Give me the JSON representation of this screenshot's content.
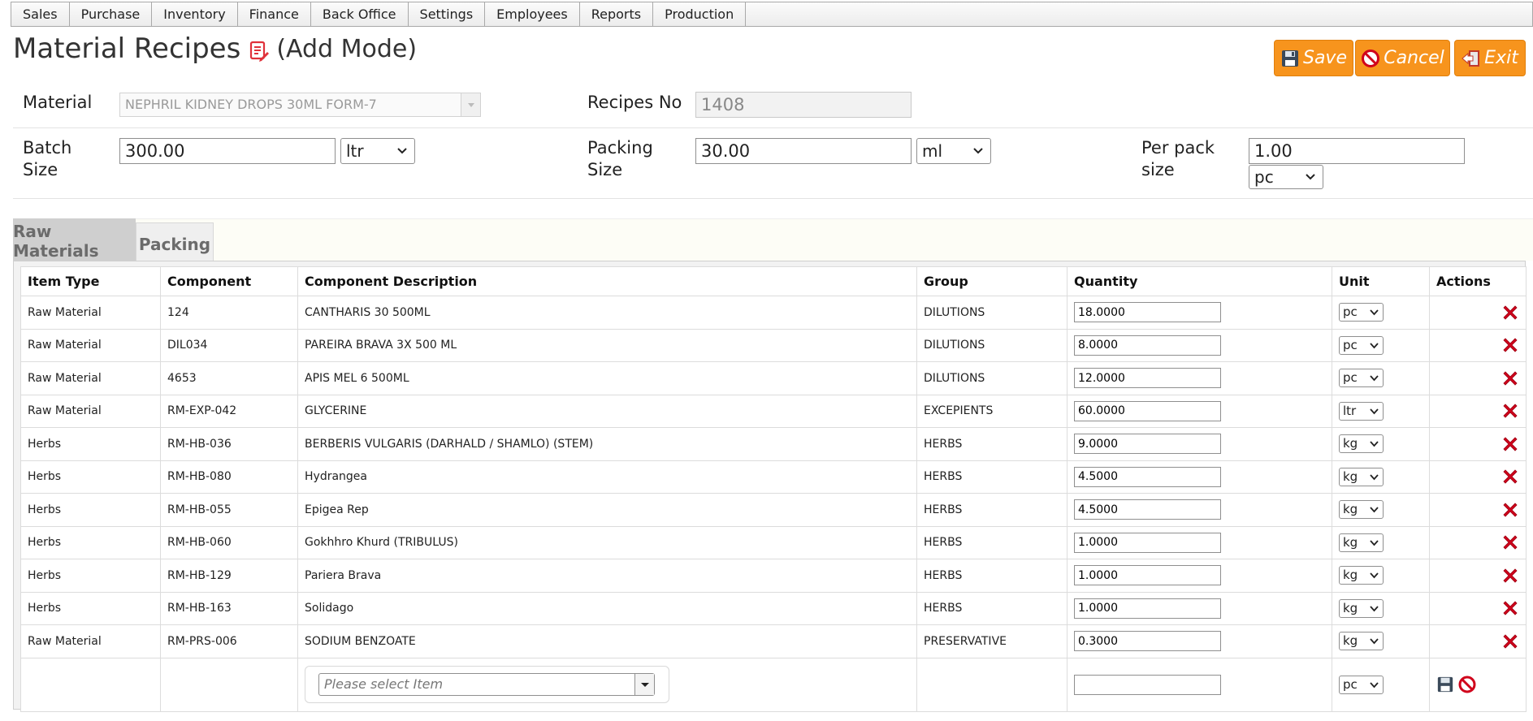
{
  "menu": [
    "Sales",
    "Purchase",
    "Inventory",
    "Finance",
    "Back Office",
    "Settings",
    "Employees",
    "Reports",
    "Production"
  ],
  "title": {
    "text": "Material Recipes",
    "mode": "(Add Mode)"
  },
  "buttons": {
    "save": "Save",
    "cancel": "Cancel",
    "exit": "Exit"
  },
  "form": {
    "material_label": "Material",
    "material_value": "NEPHRIL KIDNEY DROPS 30ML FORM-7",
    "recipes_no_label": "Recipes No",
    "recipes_no_value": "1408",
    "batch_size_label_1": "Batch",
    "batch_size_label_2": "Size",
    "batch_size_value": "300.00",
    "batch_unit": "ltr",
    "packing_size_label_1": "Packing",
    "packing_size_label_2": "Size",
    "packing_size_value": "30.00",
    "packing_unit": "ml",
    "per_pack_label_1": "Per pack",
    "per_pack_label_2": "size",
    "per_pack_value": "1.00",
    "per_pack_unit": "pc"
  },
  "tabs": {
    "raw_materials": "Raw Materials",
    "packing": "Packing"
  },
  "table": {
    "headers": [
      "Item Type",
      "Component",
      "Component Description",
      "Group",
      "Quantity",
      "Unit",
      "Actions"
    ],
    "rows": [
      {
        "type": "Raw Material",
        "component": "124",
        "description": "CANTHARIS 30 500ML",
        "group": "DILUTIONS",
        "qty": "18.0000",
        "unit": "pc"
      },
      {
        "type": "Raw Material",
        "component": "DIL034",
        "description": "PAREIRA BRAVA 3X 500 ML",
        "group": "DILUTIONS",
        "qty": "8.0000",
        "unit": "pc"
      },
      {
        "type": "Raw Material",
        "component": "4653",
        "description": "APIS MEL 6 500ML",
        "group": "DILUTIONS",
        "qty": "12.0000",
        "unit": "pc"
      },
      {
        "type": "Raw Material",
        "component": "RM-EXP-042",
        "description": "GLYCERINE",
        "group": "EXCEPIENTS",
        "qty": "60.0000",
        "unit": "ltr"
      },
      {
        "type": "Herbs",
        "component": "RM-HB-036",
        "description": "BERBERIS VULGARIS (DARHALD / SHAMLO) (STEM)",
        "group": "HERBS",
        "qty": "9.0000",
        "unit": "kg"
      },
      {
        "type": "Herbs",
        "component": "RM-HB-080",
        "description": "Hydrangea",
        "group": "HERBS",
        "qty": "4.5000",
        "unit": "kg"
      },
      {
        "type": "Herbs",
        "component": "RM-HB-055",
        "description": "Epigea Rep",
        "group": "HERBS",
        "qty": "4.5000",
        "unit": "kg"
      },
      {
        "type": "Herbs",
        "component": "RM-HB-060",
        "description": "Gokhhro Khurd (TRIBULUS)",
        "group": "HERBS",
        "qty": "1.0000",
        "unit": "kg"
      },
      {
        "type": "Herbs",
        "component": "RM-HB-129",
        "description": "Pariera Brava",
        "group": "HERBS",
        "qty": "1.0000",
        "unit": "kg"
      },
      {
        "type": "Herbs",
        "component": "RM-HB-163",
        "description": "Solidago",
        "group": "HERBS",
        "qty": "1.0000",
        "unit": "kg"
      },
      {
        "type": "Raw Material",
        "component": "RM-PRS-006",
        "description": "SODIUM BENZOATE",
        "group": "PRESERVATIVE",
        "qty": "0.3000",
        "unit": "kg"
      }
    ],
    "new_row": {
      "item_placeholder": "Please select Item",
      "unit": "pc"
    }
  },
  "icons": {
    "edit": "edit-document-icon",
    "save": "floppy-disk-icon",
    "cancel": "no-entry-icon",
    "exit": "exit-door-icon",
    "delete": "red-x-icon",
    "dropdown": "chevron-down-icon"
  },
  "colors": {
    "accent": "#f7941d",
    "delete": "#d0021b",
    "tab_underline": "#8b1a1a"
  }
}
